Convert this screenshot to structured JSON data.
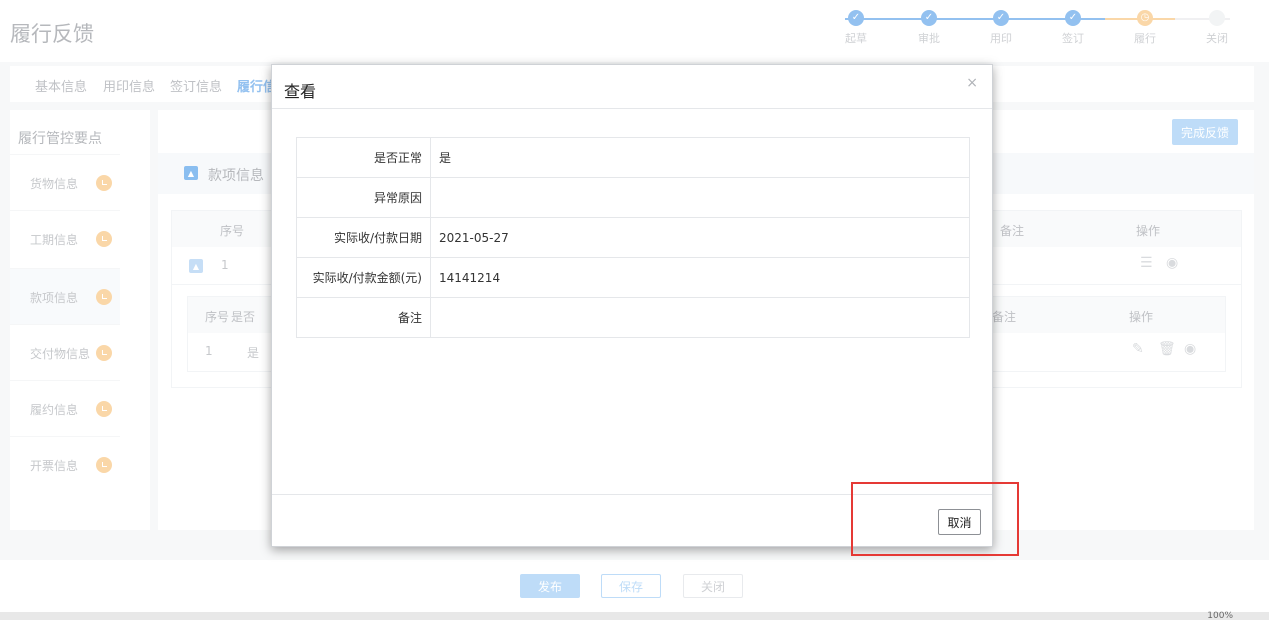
{
  "header": {
    "title": "履行反馈",
    "steps": [
      {
        "label": "起草",
        "state": "done"
      },
      {
        "label": "审批",
        "state": "done"
      },
      {
        "label": "用印",
        "state": "done"
      },
      {
        "label": "签订",
        "state": "done"
      },
      {
        "label": "履行",
        "state": "current"
      },
      {
        "label": "关闭",
        "state": "pending"
      }
    ]
  },
  "tabs": [
    "基本信息",
    "用印信息",
    "签订信息",
    "履行信"
  ],
  "sidebar": {
    "title": "履行管控要点",
    "items": [
      "货物信息",
      "工期信息",
      "款项信息",
      "交付物信息",
      "履约信息",
      "开票信息"
    ]
  },
  "main": {
    "finish_label": "完成反馈",
    "section_title": "款项信息",
    "table": {
      "headers": {
        "seq": "序号",
        "remark": "备注",
        "ops": "操作"
      },
      "row_seq": "1"
    },
    "subtable": {
      "headers": {
        "seq": "序号",
        "normal": "是否",
        "remark": "备注",
        "ops": "操作"
      },
      "row_seq": "1",
      "row_normal": "是"
    }
  },
  "bottom": {
    "publish": "发布",
    "save": "保存",
    "close": "关闭"
  },
  "status": {
    "zoom": "100%"
  },
  "modal": {
    "title": "查看",
    "close_glyph": "×",
    "fields": [
      {
        "label": "是否正常",
        "value": "是"
      },
      {
        "label": "异常原因",
        "value": ""
      },
      {
        "label": "实际收/付款日期",
        "value": "2021-05-27"
      },
      {
        "label": "实际收/付款金额(元)",
        "value": "14141214"
      },
      {
        "label": "备注",
        "value": ""
      }
    ],
    "cancel": "取消"
  },
  "colors": {
    "accent": "#4c9be8",
    "pending": "#f8c27a",
    "highlight": "#e53935"
  },
  "icons": [
    "check-icon",
    "clock-icon",
    "triangle-up-icon",
    "list-icon",
    "eye-icon",
    "edit-icon",
    "trash-icon",
    "close-icon"
  ]
}
